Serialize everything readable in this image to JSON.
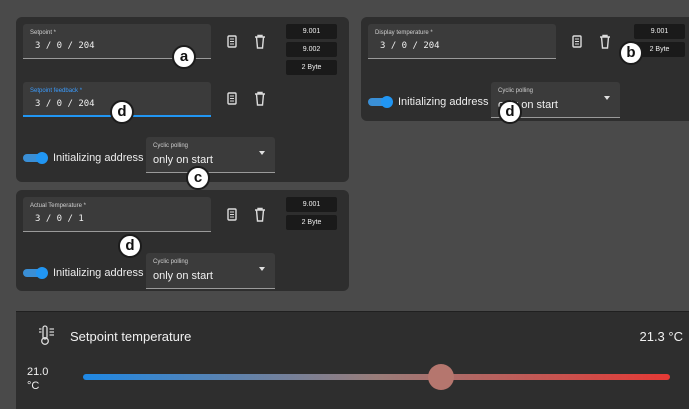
{
  "setpoint": {
    "label": "Setpoint *",
    "value": "3 / 0 / 204",
    "tags": [
      "9.001",
      "9.002",
      "2 Byte"
    ]
  },
  "setpoint_feedback": {
    "label": "Setpoint feedback *",
    "value": "3 / 0 / 204"
  },
  "setpoint_card": {
    "init_label": "Initializing address",
    "polling_label": "Cyclic polling",
    "polling_value": "only on start"
  },
  "actual_temp": {
    "label": "Actual Temperature *",
    "value": "3 / 0 /  1",
    "tags": [
      "9.001",
      "2 Byte"
    ],
    "init_label": "Initializing address",
    "polling_label": "Cyclic polling",
    "polling_value": "only on start"
  },
  "display_temp": {
    "label": "Display temperature *",
    "value": "3 / 0 / 204",
    "tags": [
      "9.001",
      "2 Byte"
    ],
    "init_label": "Initializing address",
    "polling_label": "Cyclic polling",
    "polling_value": "only on start"
  },
  "markers": {
    "a": "a",
    "b": "b",
    "c": "c",
    "d1": "d",
    "d2": "d",
    "d3": "d"
  },
  "bottom": {
    "title": "Setpoint temperature",
    "current": "21.3 °C",
    "slider_value_line1": "21.0",
    "slider_value_line2": "°C",
    "slider_fraction": 0.61,
    "gradient_start": "#1e88e5",
    "gradient_end": "#e53935",
    "thumb_color": "#b5766e"
  },
  "colors": {
    "accent": "#2196f3"
  }
}
